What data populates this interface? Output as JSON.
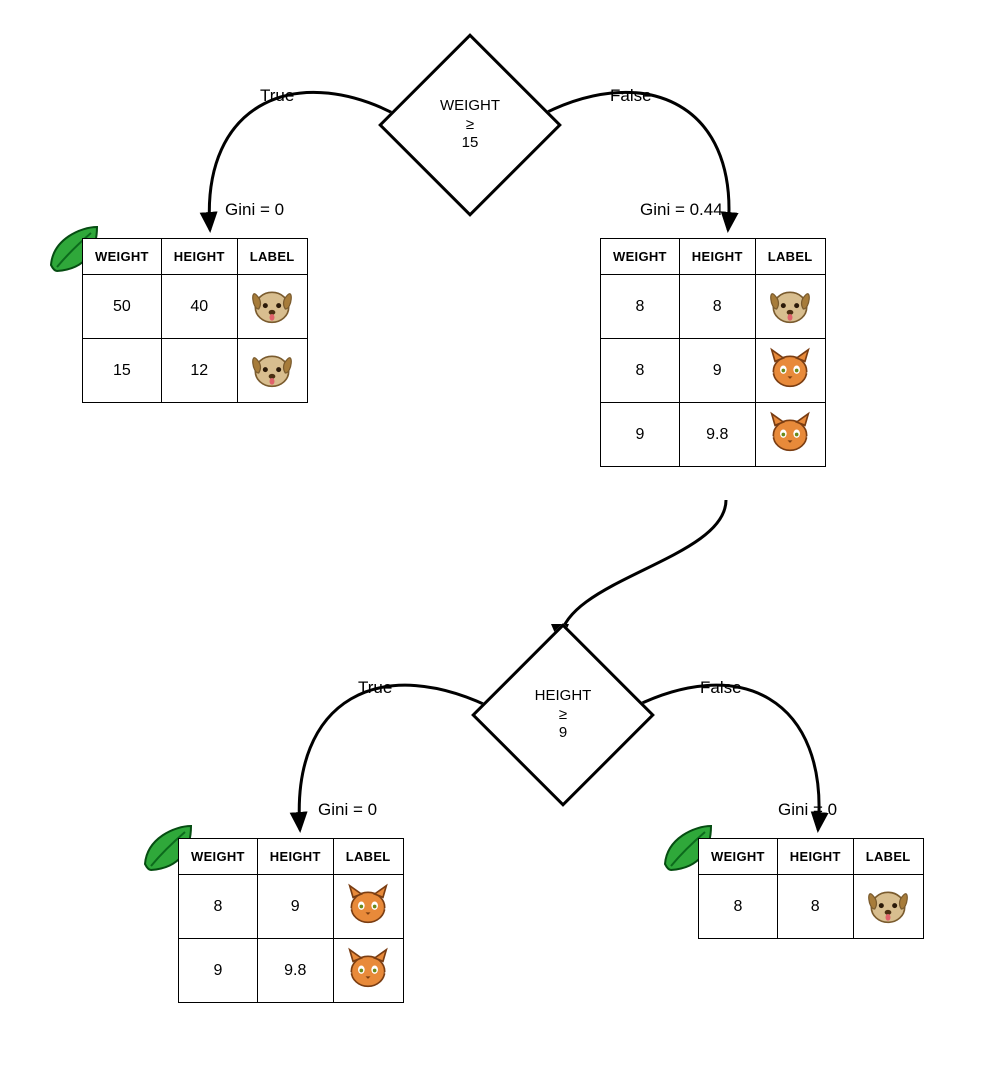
{
  "decision1": {
    "feature": "WEIGHT",
    "op": "≥",
    "threshold": "15",
    "true_label": "True",
    "false_label": "False"
  },
  "decision2": {
    "feature": "HEIGHT",
    "op": "≥",
    "threshold": "9",
    "true_label": "True",
    "false_label": "False"
  },
  "nodeA": {
    "gini": "Gini = 0",
    "headers": [
      "WEIGHT",
      "HEIGHT",
      "LABEL"
    ],
    "rows": [
      {
        "w": "50",
        "h": "40",
        "label": "dog"
      },
      {
        "w": "15",
        "h": "12",
        "label": "dog"
      }
    ],
    "is_leaf": true
  },
  "nodeB": {
    "gini": "Gini = 0.44",
    "headers": [
      "WEIGHT",
      "HEIGHT",
      "LABEL"
    ],
    "rows": [
      {
        "w": "8",
        "h": "8",
        "label": "dog"
      },
      {
        "w": "8",
        "h": "9",
        "label": "cat"
      },
      {
        "w": "9",
        "h": "9.8",
        "label": "cat"
      }
    ],
    "is_leaf": false
  },
  "nodeC": {
    "gini": "Gini = 0",
    "headers": [
      "WEIGHT",
      "HEIGHT",
      "LABEL"
    ],
    "rows": [
      {
        "w": "8",
        "h": "9",
        "label": "cat"
      },
      {
        "w": "9",
        "h": "9.8",
        "label": "cat"
      }
    ],
    "is_leaf": true
  },
  "nodeD": {
    "gini": "Gini = 0",
    "headers": [
      "WEIGHT",
      "HEIGHT",
      "LABEL"
    ],
    "rows": [
      {
        "w": "8",
        "h": "8",
        "label": "dog"
      }
    ],
    "is_leaf": true
  }
}
